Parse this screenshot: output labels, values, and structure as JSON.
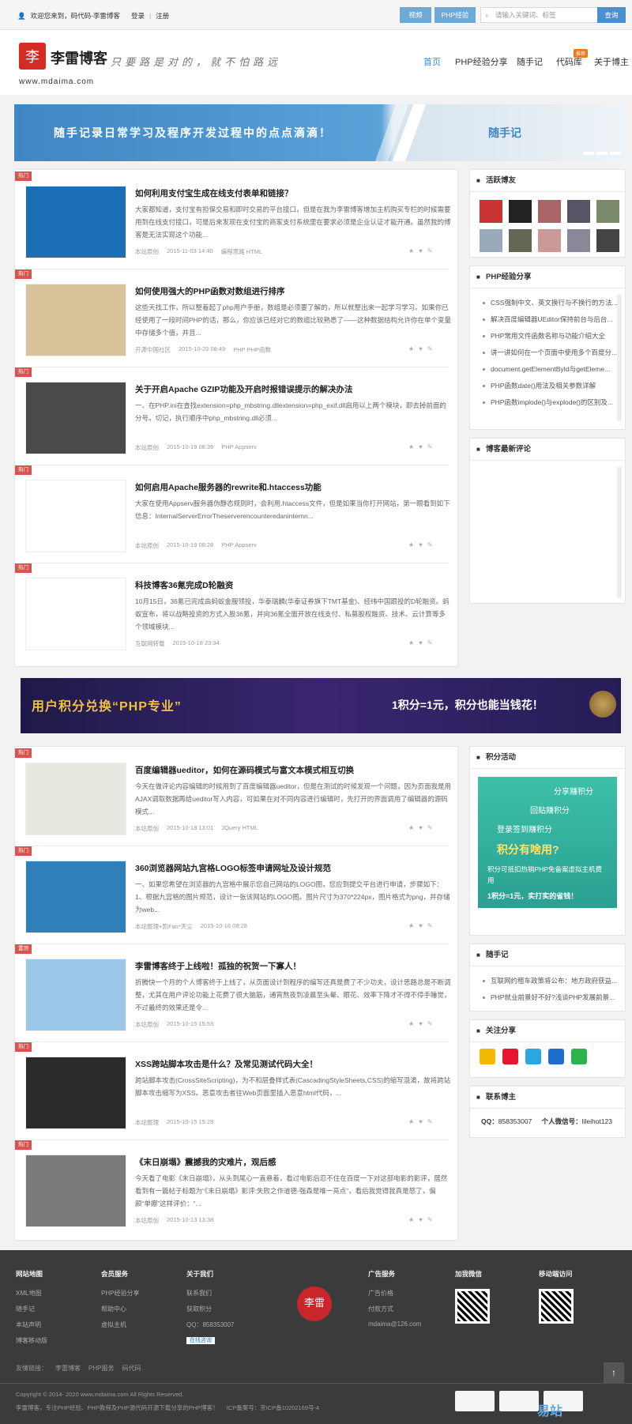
{
  "topbar": {
    "welcome": "欢迎您来到，码代码-李雷博客",
    "login": "登录",
    "sep": "|",
    "register": "注册",
    "btn_video": "视频",
    "btn_php": "PHP经验",
    "search_placeholder": "请输入关键词、标签",
    "search_btn": "查询"
  },
  "header": {
    "logo_text": "李雷博客",
    "domain": "www.mdaima.com",
    "slogan": "只要路是对的，就不怕路远",
    "nav": [
      "首页",
      "PHP经验分享",
      "随手记",
      "代码库",
      "关于博主"
    ],
    "nav_badge": "推荐"
  },
  "banner": {
    "text": "随手记录日常学习及程序开发过程中的点点滴滴！",
    "right": "随手记"
  },
  "hot_label": "热门",
  "top_label": "置顶",
  "posts1": [
    {
      "title": "如何利用支付宝生成在线支付表单和链接？",
      "desc": "大家都知道，支付宝有担保交易和即时交易的平台接口，但是在我为李雷博客增加主机购买专栏的时候需要用到在线支付接口，可是后来发现在支付宝的商家支付系统里在要求必须是企业认证才能开通。虽然我的博客是无法实现这个功能...",
      "source": "本站原创",
      "date": "2015-11-03 14:40",
      "tags": "编程思路 HTML"
    },
    {
      "title": "如何使用强大的PHP函数对数组进行排序",
      "desc": "这些天找工作，所以整着起了php用户手册，数组是必须要了解的，所以就整出来一起学习学习。如果你已经使用了一段时间PHP的话，那么，你应该已经对它的数组比较熟悉了——这种数据结构允许你在单个变量中存储多个值，并且...",
      "source": "开源中国社区",
      "date": "2015-10-20 08:49",
      "tags": "PHP PHP函数"
    },
    {
      "title": "关于开启Apache GZIP功能及开启时报错误提示的解决办法",
      "desc": "一、在PHP.ini在查找extension=php_mbstring.dllextension=php_exif.dll启用以上两个模块，即去掉前面的分号。切记，执行顺序中php_mbstring.dll必须...",
      "source": "本站原创",
      "date": "2015-10-19 08:39",
      "tags": "PHP Appserv"
    },
    {
      "title": "如何启用Apache服务器的rewrite和.htaccess功能",
      "desc": "大家在使用Appserv服务器伪静态规则时，会利用.htaccess文件，但是如果当你打开网站，第一眼看到如下信息：InternalServerErrorTheserverencounteredaninternn...",
      "source": "本站原创",
      "date": "2015-10-19 08:28",
      "tags": "PHP Appserv"
    },
    {
      "title": "科技博客36氪完成D轮融资",
      "desc": "10月15日，36氪已完成由蚂蚁金服领投，华泰瑞麟(华泰证券旗下TMT基金)、经纬中国跟投的D轮融资。蚂蚁宣布，将以战略投资的方式入股36氪，并向36氪全面开放在线支付、私募股权融资、技术、云计算等多个领域模块...",
      "source": "互联网转载",
      "date": "2015-10-18 23:34",
      "tags": ""
    }
  ],
  "ad": {
    "left": "用户积分兑换“PHP专业”",
    "right": "1积分=1元，积分也能当钱花！"
  },
  "posts2": [
    {
      "title": "百度编辑器ueditor，如何在源码模式与富文本模式相互切换",
      "desc": "今天在做评论内容编辑的时候用到了百度编辑器ueditor，但是在测试的时候发现一个问题，因为页面我是用AJAX调取数据再给ueditor写入内容，可如果在对不同内容进行编辑时，先打开的界面调用了编辑器的源码模式...",
      "source": "本站原创",
      "date": "2015-10-18 13:01",
      "tags": "JQuery HTML"
    },
    {
      "title": "360浏览器网站九宫格LOGO标签申请网址及设计规范",
      "desc": "一、如果您希望在浏览器的九宫格中展示您自己网站的LOGO图，您应到提交平台进行申请，步骤如下：1、根据九宫格的图片规范，设计一张该网站的LOGO图。图片尺寸为370*224px，图片格式为png，并存储为web...",
      "source": "本站整理+凯Fan*天尘",
      "date": "2015-10-16 08:28",
      "tags": ""
    },
    {
      "title": "李雷博客终于上线啦！孤独的祝贺一下寡人！",
      "desc": "折腾快一个月的个人博客终于上线了，从页面设计到程序的编写还真是费了不少功夫，设计思路总是不断调整，尤其在用户评论功能上花费了很大脑筋，通宵熬夜到凌晨至头晕、眼花、效率下降才不得不停手睡觉，不过最终的效果还是令...",
      "source": "本站原创",
      "date": "2015-10-15 15:53",
      "tags": ""
    },
    {
      "title": "XSS跨站脚本攻击是什么？及常见测试代码大全！",
      "desc": "跨站脚本攻击(CrossSiteScripting)，为不和层叠样式表(CascadingStyleSheets,CSS)的缩写混淆，故将跨站脚本攻击缩写为XSS。恶意攻击者往Web页面里插入恶意html代码，...",
      "source": "本站整理",
      "date": "2015-10-15 15:29",
      "tags": ""
    },
    {
      "title": "《末日崩塌》震撼我的灾难片，观后感",
      "desc": "今天看了电影《末日崩塌》，从头到尾心一直悬着，看过电影后忍不住在百度一下对这部电影的影评，居然看到有一篇帖子标题为“《末日崩塌》影评:失败之作道德-强森是唯一亮点”，看后我觉得我真是怒了，偏颇“单娜”这样评价：“...",
      "source": "本站原创",
      "date": "2015-10-13 13:38",
      "tags": ""
    }
  ],
  "sidebar": {
    "active_title": "活跃博友",
    "php_title": "PHP经验分享",
    "php_items": [
      "CSS强制中文、英文换行与不换行的方法...",
      "解决百度编辑器UEditor保持前台与后台...",
      "PHP常用文件函数名称与功能介绍大全",
      "讲一讲如何在一个页面中使用多个百度分...",
      "document.getElementById与getEleme...",
      "PHP函数date()用法及相关参数详解",
      "PHP函数implode()与explode()的区别及..."
    ],
    "comments_title": "博客最新评论",
    "jifen_title": "积分活动",
    "jifen_lines": [
      "分享赚积分",
      "回贴赚积分",
      "登录签到赚积分",
      "积分有啥用?",
      "积分可抵扣热销PHP免备案虚拟主机费用",
      "1积分=1元，实打实的省钱！"
    ],
    "note_title": "随手记",
    "note_items": [
      "互联网约租车政策将公布：地方政府获益...",
      "PHP就业前景好不好?浅谈PHP发展前景..."
    ],
    "share_title": "关注分享",
    "contact_title": "联系博主",
    "qq_label": "QQ：",
    "qq": "858353007",
    "wx_label": "个人微信号：",
    "wx": "lileihot123"
  },
  "footer": {
    "col1": {
      "title": "网站地图",
      "items": [
        "XML地图",
        "随手记",
        "本站声明",
        "博客移动版"
      ]
    },
    "col2": {
      "title": "会员服务",
      "items": [
        "PHP经验分享",
        "帮助中心",
        "虚拟主机"
      ]
    },
    "col3": {
      "title": "关于我们",
      "items": [
        "联系我们",
        "获取积分",
        "QQ：858353007",
        "在线咨询"
      ]
    },
    "col4": {
      "title": "广告服务",
      "items": [
        "广告价格",
        "付款方式",
        "mdaima@126.com"
      ]
    },
    "wechat": "加我微信",
    "mobile": "移动端访问",
    "seal": "李雷",
    "flinks_label": "友情链接：",
    "flinks": [
      "李雷博客",
      "PHP服务",
      "码代码"
    ],
    "copyright": "Copyright © 2014- 2020 www.mdaima.com All Rights Reserved.",
    "bottom1": "李雷博客，专注PHP经验、PHP教程及PHP源代码开源下载分享的PHP博客！",
    "bottom2": "ICP备案号：京ICP备10202169号-4",
    "watermark": "易站"
  }
}
